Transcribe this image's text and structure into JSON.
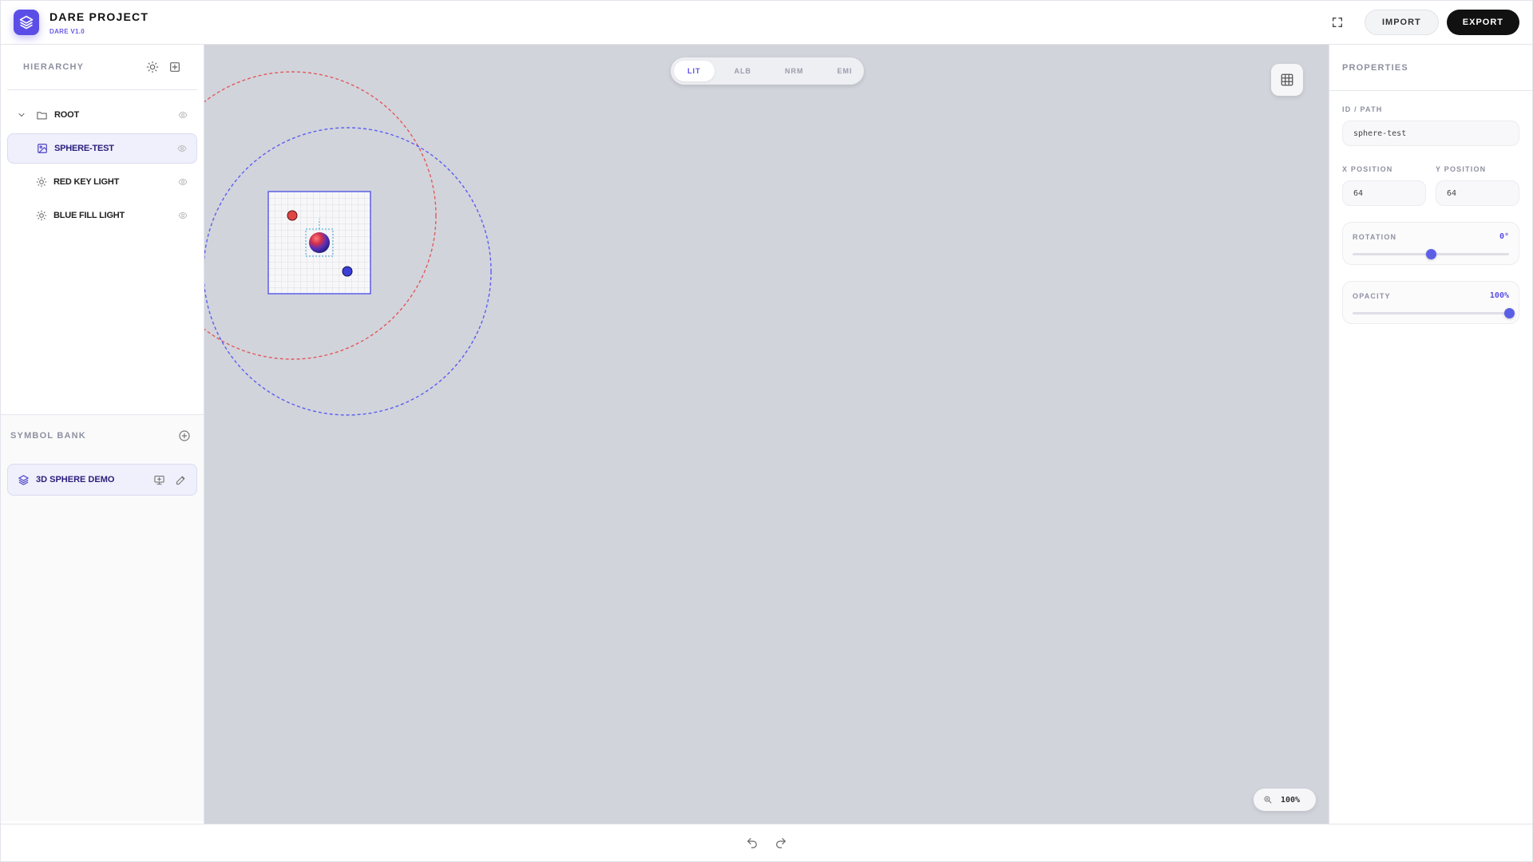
{
  "app": {
    "title": "DARE PROJECT",
    "version": "DARE V1.0",
    "accent": "#5b4ee6"
  },
  "toolbar": {
    "import_label": "IMPORT",
    "export_label": "EXPORT",
    "icons": [
      "layers-icon",
      "fullscreen-icon"
    ]
  },
  "hierarchy": {
    "title": "HIERARCHY",
    "items": [
      {
        "label": "ROOT",
        "icon": "folder-icon",
        "expanded": true
      },
      {
        "label": "SPHERE-TEST",
        "icon": "image-icon",
        "selected": true
      },
      {
        "label": "RED KEY LIGHT",
        "icon": "sun-icon"
      },
      {
        "label": "BLUE FILL LIGHT",
        "icon": "sun-icon"
      }
    ]
  },
  "symbol_bank": {
    "title": "SYMBOL BANK",
    "items": [
      {
        "label": "3D SPHERE DEMO",
        "icon": "layers-icon"
      }
    ]
  },
  "viewport": {
    "tabs": [
      {
        "label": "LIT",
        "active": true
      },
      {
        "label": "ALB"
      },
      {
        "label": "NRM"
      },
      {
        "label": "EMI"
      }
    ],
    "zoom": "100%",
    "light_colors": {
      "red": "#e04545",
      "blue": "#3b3fd8"
    }
  },
  "properties": {
    "title": "PROPERTIES",
    "id_label": "ID / PATH",
    "id_value": "sphere-test",
    "x_label": "X POSITION",
    "x_value": "64",
    "y_label": "Y POSITION",
    "y_value": "64",
    "rotation": {
      "label": "ROTATION",
      "value_text": "0°",
      "fraction": 0.5
    },
    "opacity": {
      "label": "OPACITY",
      "value_text": "100%",
      "fraction": 1.0
    }
  }
}
